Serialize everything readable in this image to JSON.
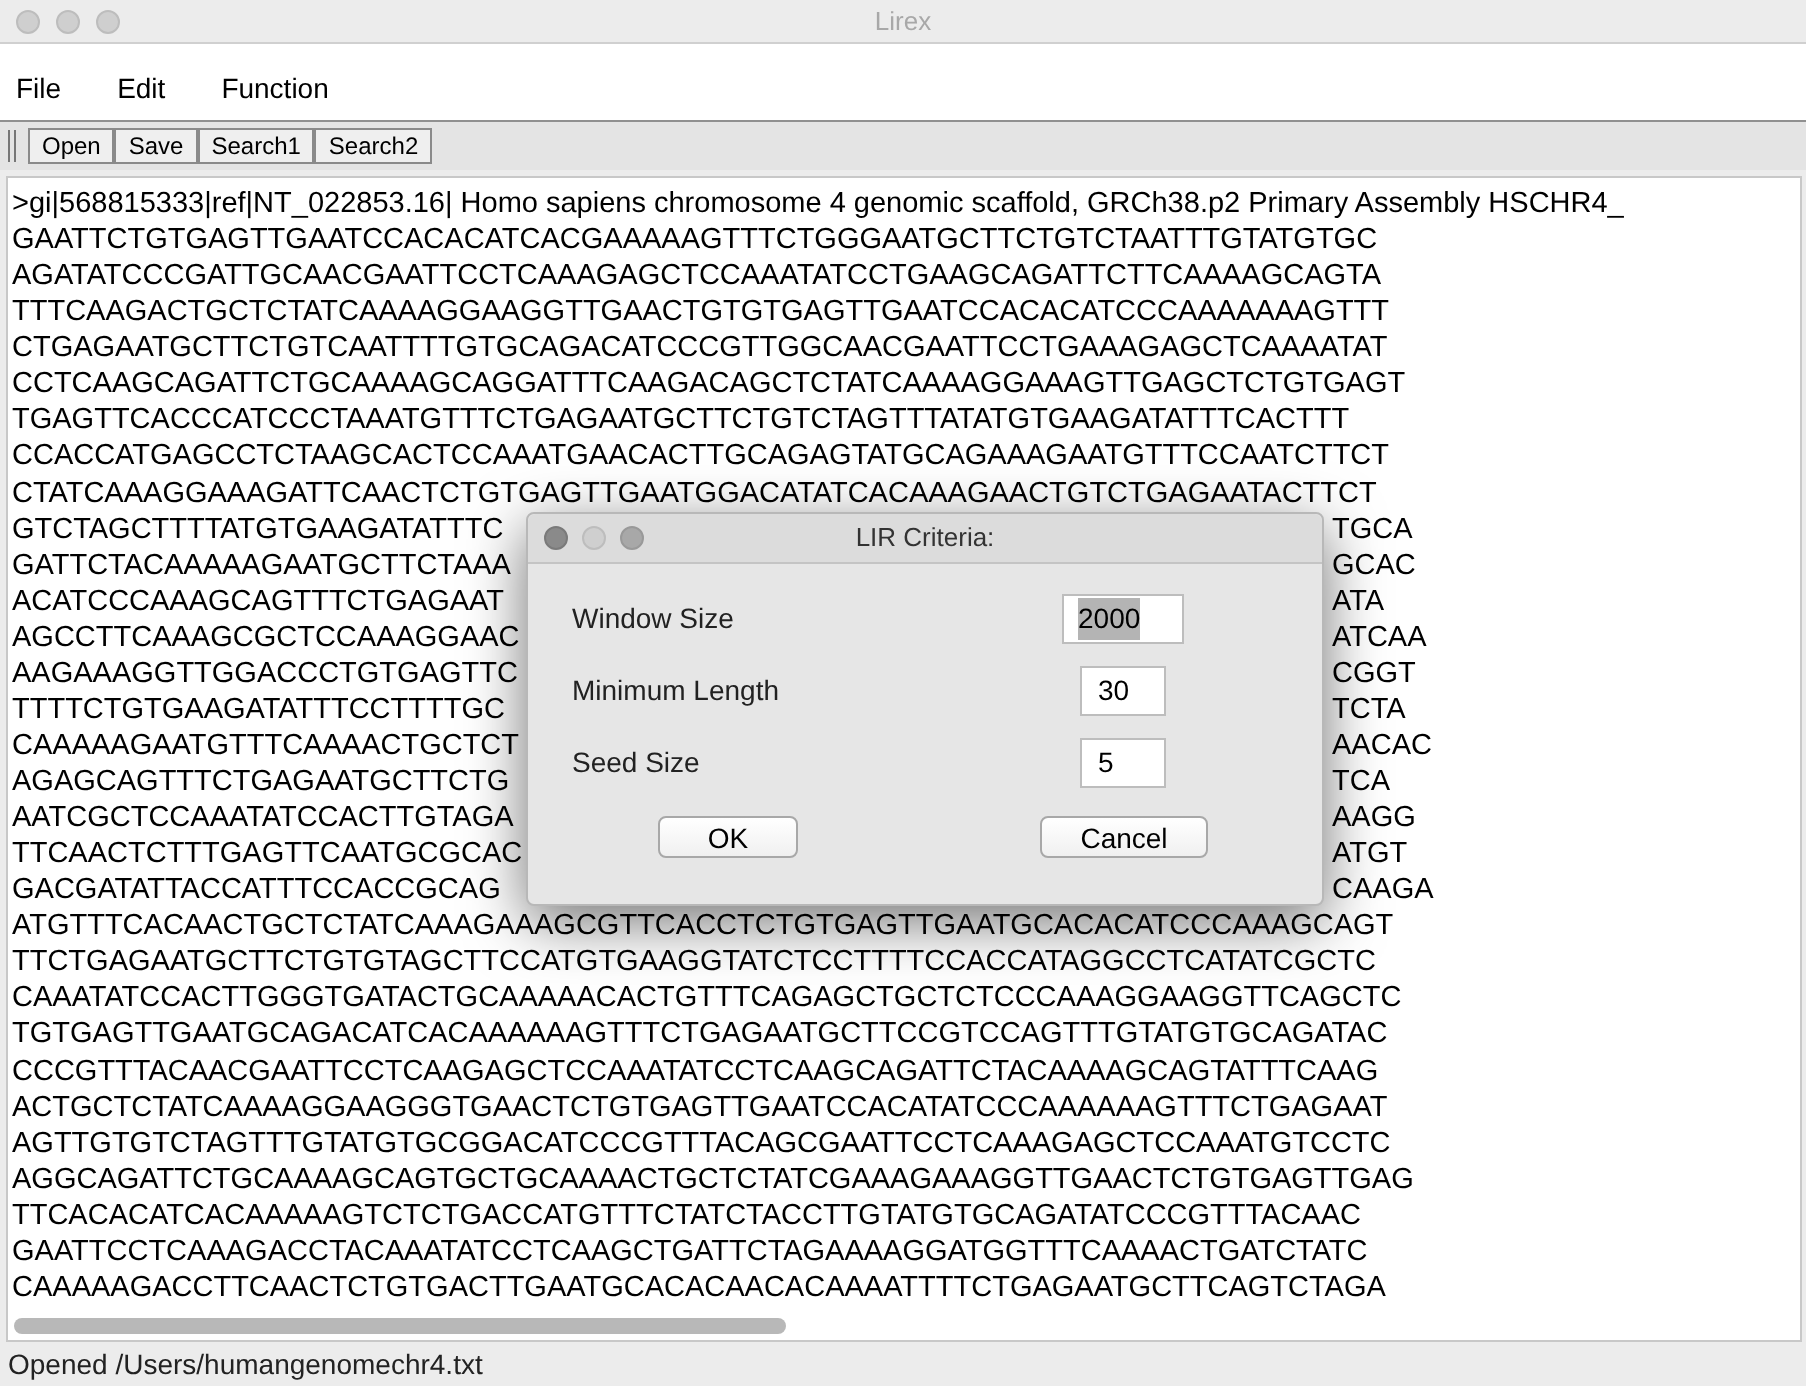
{
  "window": {
    "title": "Lirex"
  },
  "menu": [
    "File",
    "Edit",
    "Function"
  ],
  "toolbar": [
    "Open",
    "Save",
    "Search1",
    "Search2"
  ],
  "editor": {
    "lines": [
      {
        "kind": "full",
        "text": ">gi|568815333|ref|NT_022853.16| Homo sapiens chromosome 4 genomic scaffold, GRCh38.p2 Primary Assembly HSCHR4_"
      },
      {
        "kind": "full",
        "text": "GAATTCTGTGAGTTGAATCCACACATCACGAAAAAGTTTCTGGGAATGCTTCTGTCTAATTTGTATGTGC"
      },
      {
        "kind": "full",
        "text": "AGATATCCCGATTGCAACGAATTCCTCAAAGAGCTCCAAATATCCTGAAGCAGATTCTTCAAAAGCAGTA"
      },
      {
        "kind": "full",
        "text": "TTTCAAGACTGCTCTATCAAAAGGAAGGTTGAACTGTGTGAGTTGAATCCACACATCCCAAAAAAAGTTT"
      },
      {
        "kind": "full",
        "text": "CTGAGAATGCTTCTGTCAATTTTGTGCAGACATCCCGTTGGCAACGAATTCCTGAAAGAGCTCAAAATAT"
      },
      {
        "kind": "full",
        "text": "CCTCAAGCAGATTCTGCAAAAGCAGGATTTCAAGACAGCTCTATCAAAAGGAAAGTTGAGCTCTGTGAGT"
      },
      {
        "kind": "full",
        "text": "TGAGTTCACCCATCCCTAAATGTTTCTGAGAATGCTTCTGTCTAGTTTATATGTGAAGATATTTCACTTT"
      },
      {
        "kind": "full",
        "text": "CCACCATGAGCCTCTAAGCACTCCAAATGAACACTTGCAGAGTATGCAGAAAGAATGTTTCCAATCTTCT"
      },
      {
        "kind": "full",
        "text": "CTATCAAAGGAAAGATTCAACTCTGTGAGTTGAATGGACATATCACAAAGAACTGTCTGAGAATACTTCT"
      },
      {
        "kind": "split",
        "left": "GTCTAGCTTTTATGTGAAGATATTTC",
        "right": "TGCA"
      },
      {
        "kind": "split",
        "left": "GATTCTACAAAAAGAATGCTTCTAAA",
        "right": "GCAC"
      },
      {
        "kind": "split",
        "left": "ACATCCCAAAGCAGTTTCTGAGAAT",
        "right": "ATA"
      },
      {
        "kind": "split",
        "left": "AGCCTTCAAAGCGCTCCAAAGGAAC",
        "right": "ATCAA"
      },
      {
        "kind": "split",
        "left": "AAGAAAGGTTGGACCCTGTGAGTTC",
        "right": "CGGT"
      },
      {
        "kind": "split",
        "left": "TTTTCTGTGAAGATATTTCCTTTTGC",
        "right": "TCTA"
      },
      {
        "kind": "split",
        "left": "CAAAAAGAATGTTTCAAAACTGCTCT",
        "right": "AACAC"
      },
      {
        "kind": "split",
        "left": "AGAGCAGTTTCTGAGAATGCTTCTG",
        "right": "TCA"
      },
      {
        "kind": "split",
        "left": "AATCGCTCCAAATATCCACTTGTAGA",
        "right": "AAGG"
      },
      {
        "kind": "split",
        "left": "TTCAACTCTTTGAGTTCAATGCGCAC",
        "right": "ATGT"
      },
      {
        "kind": "split",
        "left": "GACGATATTACCATTTCCACCGCAG",
        "right": "CAAGA"
      },
      {
        "kind": "full",
        "text": "ATGTTTCACAACTGCTCTATCAAAGAAAGCGTTCACCTCTGTGAGTTGAATGCACACATCCCAAAGCAGT"
      },
      {
        "kind": "full",
        "text": "TTCTGAGAATGCTTCTGTGTAGCTTCCATGTGAAGGTATCTCCTTTTCCACCATAGGCCTCATATCGCTC"
      },
      {
        "kind": "full",
        "text": "CAAATATCCACTTGGGTGATACTGCAAAAACACTGTTTCAGAGCTGCTCTCCCAAAGGAAGGTTCAGCTC"
      },
      {
        "kind": "full",
        "text": "TGTGAGTTGAATGCAGACATCACAAAAAAGTTTCTGAGAATGCTTCCGTCCAGTTTGTATGTGCAGATAC"
      },
      {
        "kind": "full",
        "text": "CCCGTTTACAACGAATTCCTCAAGAGCTCCAAATATCCTCAAGCAGATTCTACAAAAGCAGTATTTCAAG"
      },
      {
        "kind": "full",
        "text": "ACTGCTCTATCAAAAGGAAGGGTGAACTCTGTGAGTTGAATCCACATATCCCAAAAAAGTTTCTGAGAAT"
      },
      {
        "kind": "full",
        "text": "AGTTGTGTCTAGTTTGTATGTGCGGACATCCCGTTTACAGCGAATTCCTCAAAGAGCTCCAAATGTCCTC"
      },
      {
        "kind": "full",
        "text": "AGGCAGATTCTGCAAAAGCAGTGCTGCAAAACTGCTCTATCGAAAGAAAGGTTGAACTCTGTGAGTTGAG"
      },
      {
        "kind": "full",
        "text": "TTCACACATCACAAAAAGTCTCTGACCATGTTTCTATCTACCTTGTATGTGCAGATATCCCGTTTACAAC"
      },
      {
        "kind": "full",
        "text": "GAATTCCTCAAAGACCTACAAATATCCTCAAGCTGATTCTAGAAAAGGATGGTTTCAAAACTGATCTATC"
      },
      {
        "kind": "full",
        "text": "CAAAAAGACCTTCAACTCTGTGACTTGAATGCACACAACACAAAATTTTCTGAGAATGCTTCAGTCTAGA"
      }
    ]
  },
  "dialog": {
    "title": "LIR Criteria:",
    "fields": [
      {
        "label": "Window Size",
        "value": "2000",
        "text_selected": true
      },
      {
        "label": "Minimum Length",
        "value": "30",
        "text_selected": false
      },
      {
        "label": "Seed Size",
        "value": "5",
        "text_selected": false
      }
    ],
    "buttons": [
      "OK",
      "Cancel"
    ]
  },
  "status_bar": "Opened /Users/humangenomechr4.txt"
}
